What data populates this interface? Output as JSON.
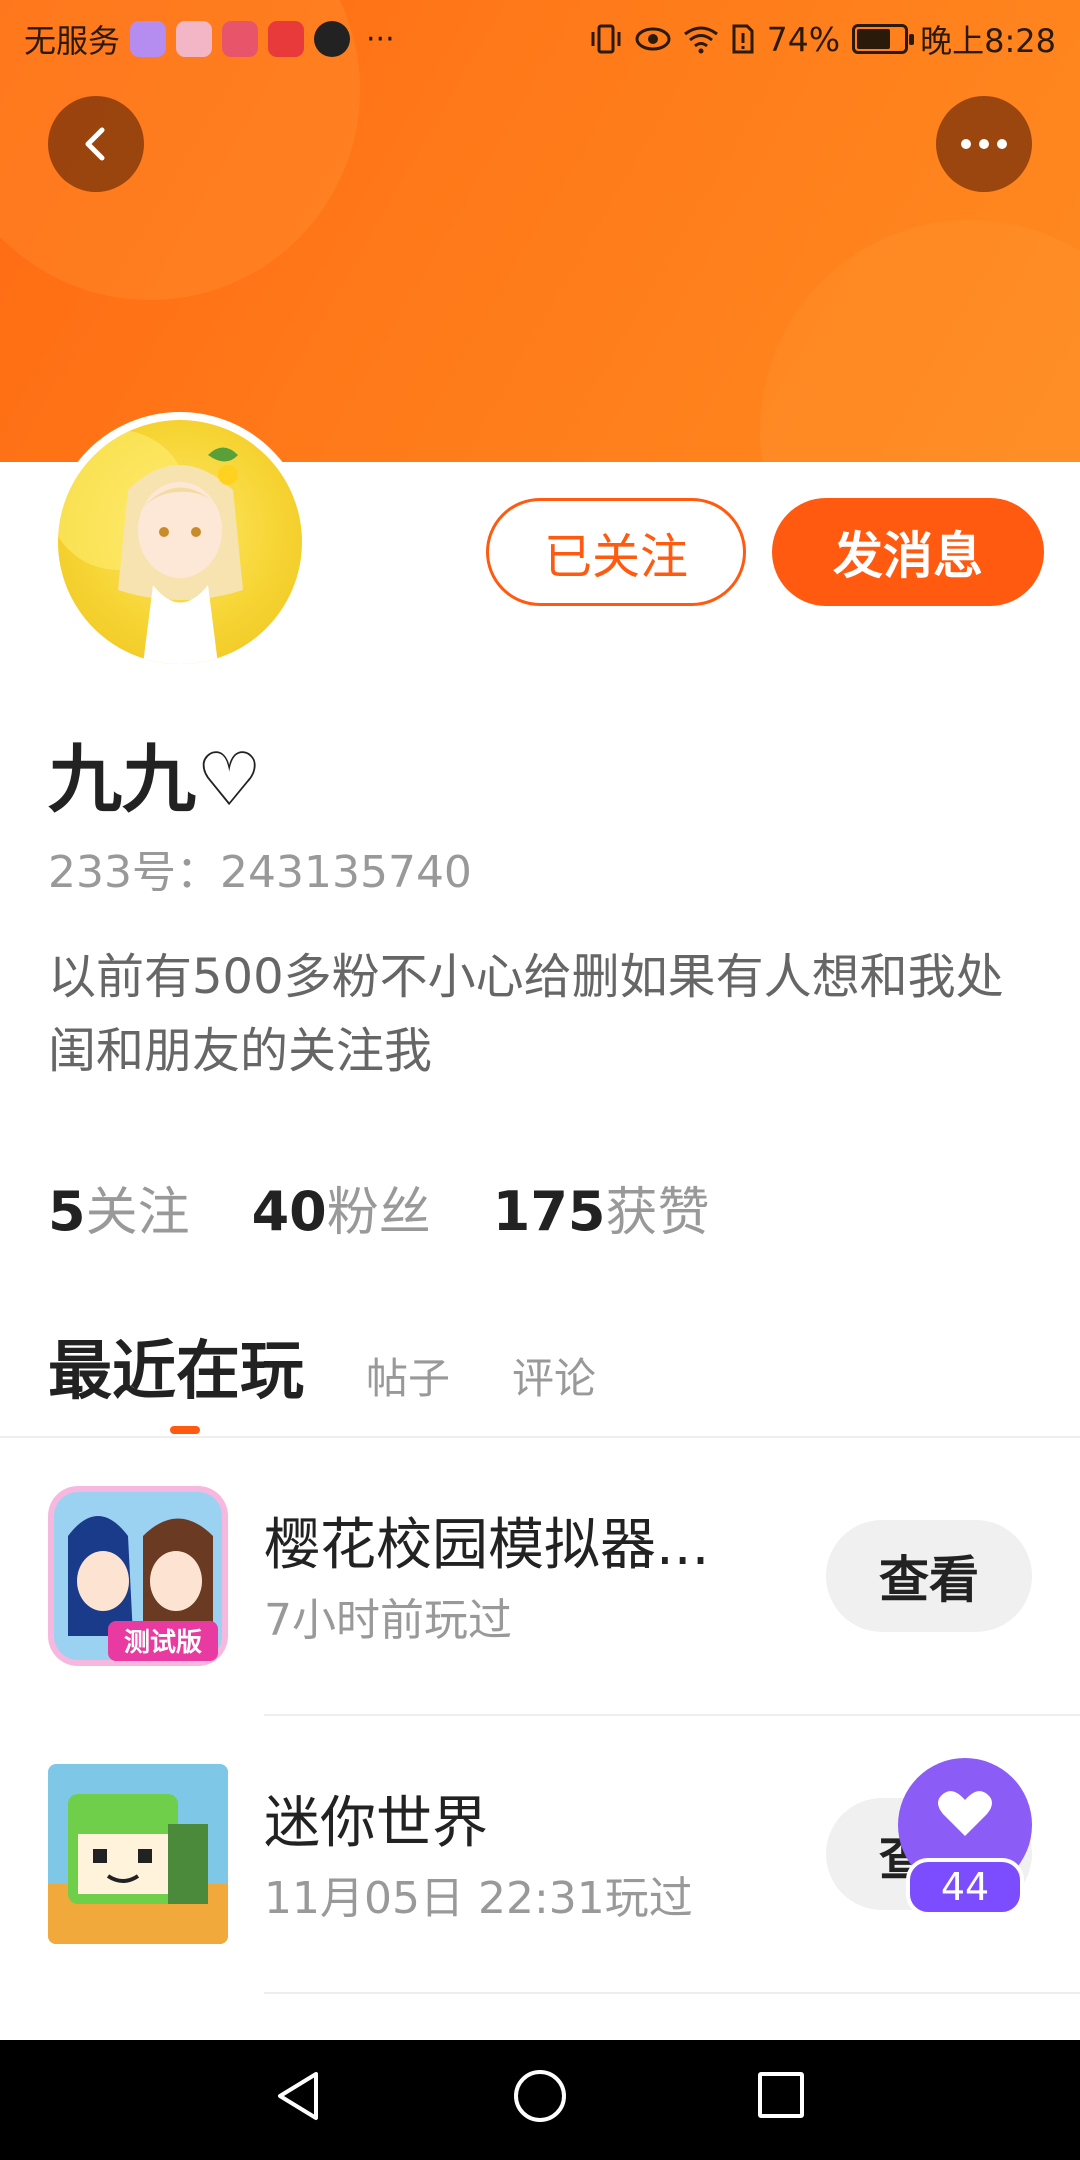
{
  "status_bar": {
    "carrier": "无服务",
    "more": "···",
    "battery_percent": "74%",
    "battery_level": 0.74,
    "time": "晚上8:28"
  },
  "header": {
    "back_icon": "chevron-left-icon",
    "more_icon": "more-dots-icon"
  },
  "profile": {
    "follow_label": "已关注",
    "message_label": "发消息",
    "name": "九九♡",
    "uid": "233号：243135740",
    "bio": "以前有500多粉不小心给删如果有人想和我处闺和朋友的关注我",
    "stats": [
      {
        "num": "5",
        "label": "关注"
      },
      {
        "num": "40",
        "label": "粉丝"
      },
      {
        "num": "175",
        "label": "获赞"
      }
    ]
  },
  "tabs": {
    "active": "最近在玩",
    "posts": "帖子",
    "comments": "评论"
  },
  "games": [
    {
      "title": "樱花校园模拟器...",
      "subtitle": "7小时前玩过",
      "button": "查看",
      "badge": "测试版"
    },
    {
      "title": "迷你世界",
      "subtitle": "11月05日 22:31玩过",
      "button": "查看"
    }
  ],
  "like_fab": {
    "count": "44",
    "icon": "heart-icon"
  },
  "colors": {
    "accent": "#ff5a10",
    "fab": "#8b5cf6"
  }
}
